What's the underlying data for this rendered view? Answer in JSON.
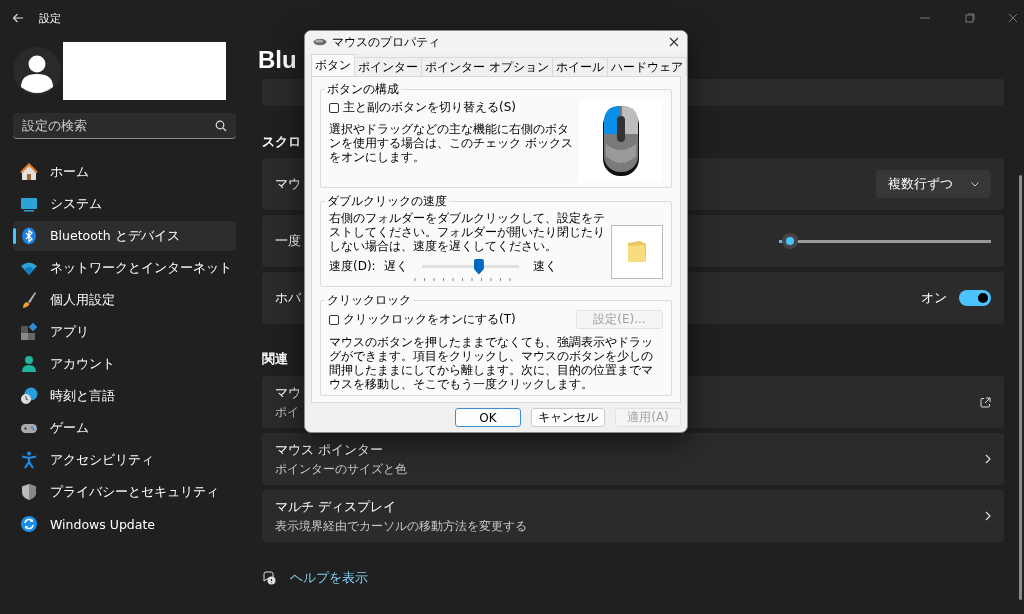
{
  "window": {
    "title": "設定"
  },
  "sidebar": {
    "search": {
      "placeholder": "設定の検索"
    },
    "items": [
      {
        "kind": "home",
        "label": "ホーム",
        "selected": false
      },
      {
        "kind": "system",
        "label": "システム",
        "selected": false
      },
      {
        "kind": "bluetooth",
        "label": "Bluetooth とデバイス",
        "selected": true
      },
      {
        "kind": "network",
        "label": "ネットワークとインターネット",
        "selected": false
      },
      {
        "kind": "personalize",
        "label": "個人用設定",
        "selected": false
      },
      {
        "kind": "apps",
        "label": "アプリ",
        "selected": false
      },
      {
        "kind": "account",
        "label": "アカウント",
        "selected": false
      },
      {
        "kind": "time",
        "label": "時刻と言語",
        "selected": false
      },
      {
        "kind": "game",
        "label": "ゲーム",
        "selected": false
      },
      {
        "kind": "accessibility",
        "label": "アクセシビリティ",
        "selected": false
      },
      {
        "kind": "privacy",
        "label": "プライバシーとセキュリティ",
        "selected": false
      },
      {
        "kind": "update",
        "label": "Windows Update",
        "selected": false
      }
    ]
  },
  "main": {
    "heading": "Blu",
    "sections": [
      {
        "title": "スクロ",
        "cards": [
          {
            "kind": "dropdown",
            "title": "マウ",
            "value": "複数行ずつ"
          },
          {
            "kind": "slider",
            "title": "一度",
            "level": 0.05
          },
          {
            "kind": "toggle",
            "title": "ホバ",
            "state_label": "オン",
            "on": true
          }
        ]
      },
      {
        "title": "関連",
        "cards": [
          {
            "kind": "external",
            "title": "マウ",
            "subtitle": "ポイ"
          },
          {
            "kind": "link",
            "title": "マウス ポインター",
            "subtitle": "ポインターのサイズと色"
          },
          {
            "kind": "link",
            "title": "マルチ ディスプレイ",
            "subtitle": "表示境界経由でカーソルの移動方法を変更する"
          }
        ]
      }
    ],
    "help_link": "ヘルプを表示"
  },
  "dialog": {
    "title": "マウスのプロパティ",
    "tabs": [
      {
        "label": "ボタン",
        "selected": true
      },
      {
        "label": "ポインター",
        "selected": false
      },
      {
        "label": "ポインター オプション",
        "selected": false
      },
      {
        "label": "ホイール",
        "selected": false
      },
      {
        "label": "ハードウェア",
        "selected": false
      }
    ],
    "button_config": {
      "title": "ボタンの構成",
      "checkbox": {
        "label": "主と副のボタンを切り替える(S)",
        "checked": false
      },
      "description": "選択やドラッグなどの主な機能に右側のボタンを使用する場合は、このチェック ボックスをオンにします。"
    },
    "double_click": {
      "title": "ダブルクリックの速度",
      "description": "右側のフォルダーをダブルクリックして、設定をテストしてください。フォルダーが開いたり閉じたりしない場合は、速度を遅くしてください。",
      "speed_label": "速度(D):",
      "slow_label": "遅く",
      "fast_label": "速く",
      "level": 0.59
    },
    "click_lock": {
      "title": "クリックロック",
      "checkbox": {
        "label": "クリックロックをオンにする(T)",
        "checked": false
      },
      "settings_button": {
        "label": "設定(E)...",
        "disabled": true
      },
      "description": "マウスのボタンを押したままでなくても、強調表示やドラッグができます。項目をクリックし、マウスのボタンを少しの間押したままにしてから離します。次に、目的の位置までマウスを移動し、そこでもう一度クリックします。"
    },
    "buttons": [
      {
        "label": "OK",
        "default": true,
        "disabled": false
      },
      {
        "label": "キャンセル",
        "default": false,
        "disabled": false
      },
      {
        "label": "適用(A)",
        "default": false,
        "disabled": true
      }
    ]
  }
}
